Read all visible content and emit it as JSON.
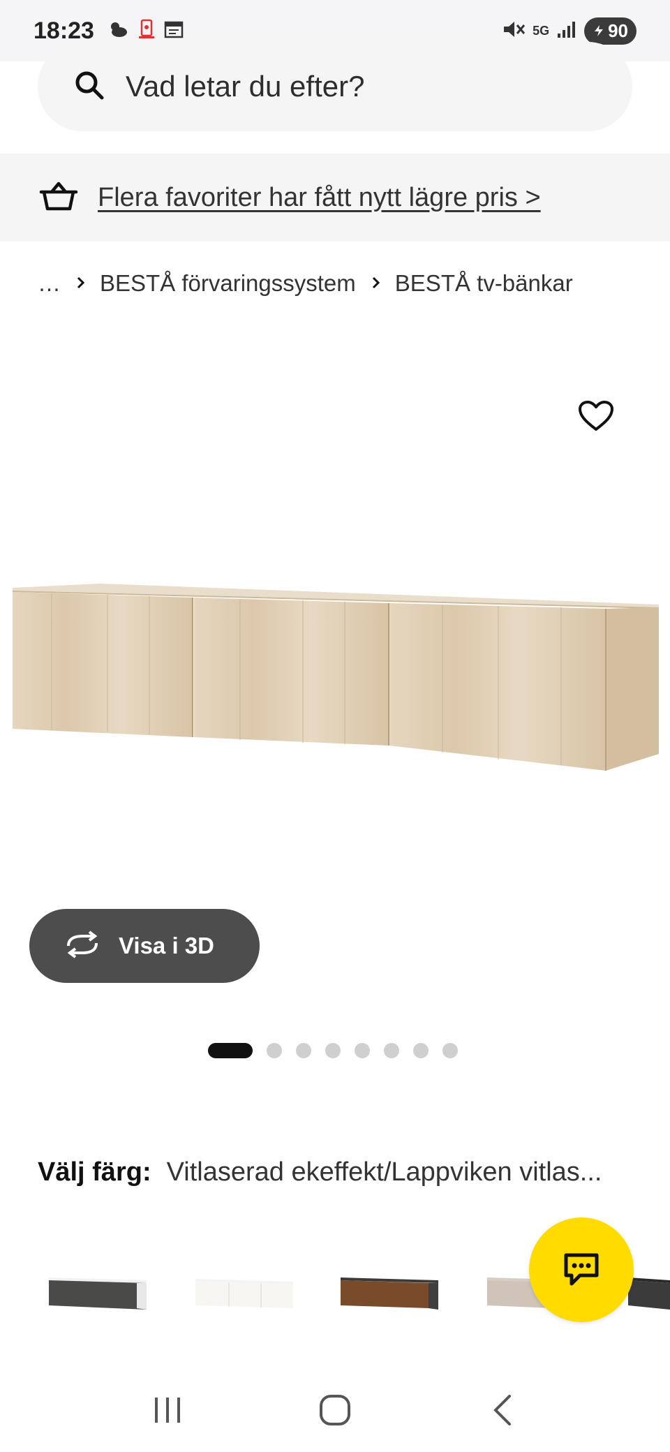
{
  "status_bar": {
    "time": "18:23",
    "network": "5G",
    "battery": "90",
    "icons_left": [
      "weather-icon",
      "notification-app-icon",
      "calendar-icon"
    ],
    "icons_right": [
      "mute-icon",
      "5g-icon",
      "signal-icon",
      "battery-icon"
    ]
  },
  "search": {
    "placeholder": "Vad letar du efter?"
  },
  "promo": {
    "text": "Flera favoriter har fått nytt lägre pris >"
  },
  "breadcrumb": {
    "items": [
      "…",
      "BESTÅ förvaringssystem",
      "BESTÅ tv-bänkar"
    ]
  },
  "product": {
    "view_3d_label": "Visa i 3D",
    "carousel": {
      "total": 8,
      "active_index": 0
    }
  },
  "color": {
    "label": "Välj färg:",
    "value": "Vitlaserad ekeffekt/Lappviken vitlas..."
  },
  "swatches": [
    {
      "name": "black-white"
    },
    {
      "name": "white"
    },
    {
      "name": "walnut-dark"
    },
    {
      "name": "beige-grey"
    },
    {
      "name": "black"
    }
  ],
  "colors": {
    "accent_yellow": "#ffdb00",
    "button_dark": "#4d4d4d",
    "surface_grey": "#f5f5f5"
  }
}
